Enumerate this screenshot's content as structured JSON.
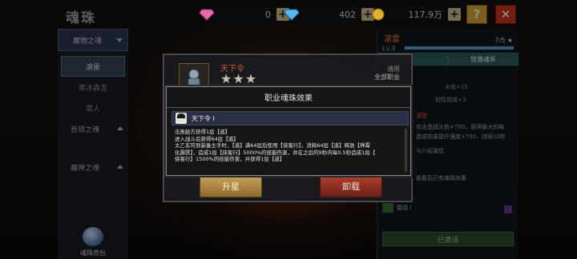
{
  "screen_title": "魂珠",
  "resources": [
    {
      "name": "pink-gem",
      "value": "0",
      "color": "#e86aa8"
    },
    {
      "name": "blue-gem",
      "value": "402",
      "color": "#5ab8f0"
    },
    {
      "name": "gold-coin",
      "value": "117.9万",
      "color": "#e0b030"
    }
  ],
  "header_buttons": {
    "help": "?",
    "close": "✕"
  },
  "sidebar": {
    "categories": [
      {
        "label": "魔物之魂",
        "expanded": true,
        "items": [
          "滚雷",
          "寒冰森龙",
          "菜人"
        ],
        "active_index": 0
      },
      {
        "label": "首领之魂",
        "expanded": false
      },
      {
        "label": "魔神之魂",
        "expanded": false
      }
    ],
    "bag_label": "魂珠背包"
  },
  "right_panel": {
    "name": "滚雷",
    "level": "Lv.3",
    "count": "7/5 ★",
    "progress": 1.0,
    "tabs": [
      "",
      "铭镌魂系"
    ],
    "lines": [
      "木攻+15",
      "韧性相减+3"
    ],
    "red_label": "滚雷",
    "text1": "攻击造成火伤+700，获得最大的每",
    "text2": "造成伤害提升强度+700，持续10秒",
    "text3": "与介绍属性",
    "text4": "装备后已有魂珠效果",
    "skill": "雷动 !",
    "activated": "已激活"
  },
  "card": {
    "name": "天下令",
    "stars": "★★★",
    "type": "通用",
    "job": "全部职业",
    "upgrade_label": "升星",
    "unload_label": "卸载"
  },
  "dialog": {
    "title": "职业魂珠效果",
    "effect_name": "天下令 I",
    "lines": [
      "击败敌方获得1层【道】",
      "进入战斗后获得64层【道】",
      "太乙玄符到装备主手时，【道】满64层后使用【侠客行】，消耗64层【道】释放【神霄",
      "化霹雳】，造成1段【侠客行】5000%的技能伤害，并在之后的9秒内每0.5秒造成1段【",
      "侠客行】1500%的技能伤害，并获得1层【道】"
    ]
  }
}
